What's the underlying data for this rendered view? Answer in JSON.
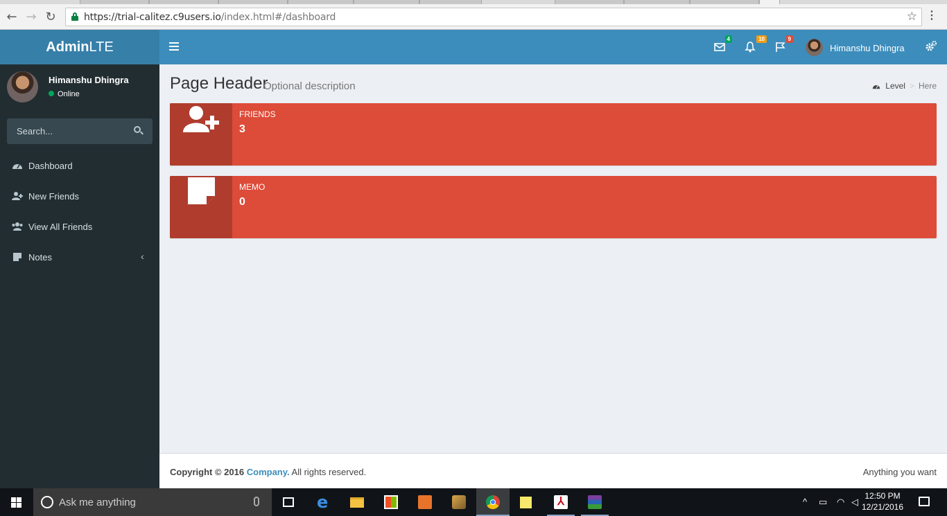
{
  "browser": {
    "url_host": "https://trial-calitez.c9users.io",
    "url_path": "/index.html#/dashboard"
  },
  "header": {
    "logo_bold": "Admin",
    "logo_rest": "LTE",
    "messages_count": "4",
    "notifications_count": "10",
    "tasks_count": "9",
    "user_name": "Himanshu Dhingra"
  },
  "sidebar": {
    "user_name": "Himanshu Dhingra",
    "status": "Online",
    "search_placeholder": "Search...",
    "items": [
      {
        "label": "Dashboard",
        "icon": "dashboard-icon"
      },
      {
        "label": "New Friends",
        "icon": "user-plus-icon"
      },
      {
        "label": "View All Friends",
        "icon": "users-icon"
      },
      {
        "label": "Notes",
        "icon": "sticky-note-icon"
      }
    ]
  },
  "content": {
    "title": "Page Header",
    "description": "Optional description",
    "breadcrumb": {
      "level": "Level",
      "here": "Here"
    },
    "boxes": [
      {
        "text": "Friends",
        "number": "3",
        "icon": "user-plus-icon",
        "color": "#dd4b39"
      },
      {
        "text": "Memo",
        "number": "0",
        "icon": "sticky-note-icon",
        "color": "#dd4b39"
      }
    ]
  },
  "footer": {
    "copyright": "Copyright © 2016",
    "company": "Company.",
    "rights": "All rights reserved.",
    "right_text": "Anything you want"
  },
  "taskbar": {
    "search_placeholder": "Ask me anything",
    "time": "12:50 PM",
    "date": "12/21/2016"
  },
  "colors": {
    "header": "#3c8dbc",
    "logo": "#367fa9",
    "sidebar": "#222d32",
    "danger": "#dd4b39"
  }
}
